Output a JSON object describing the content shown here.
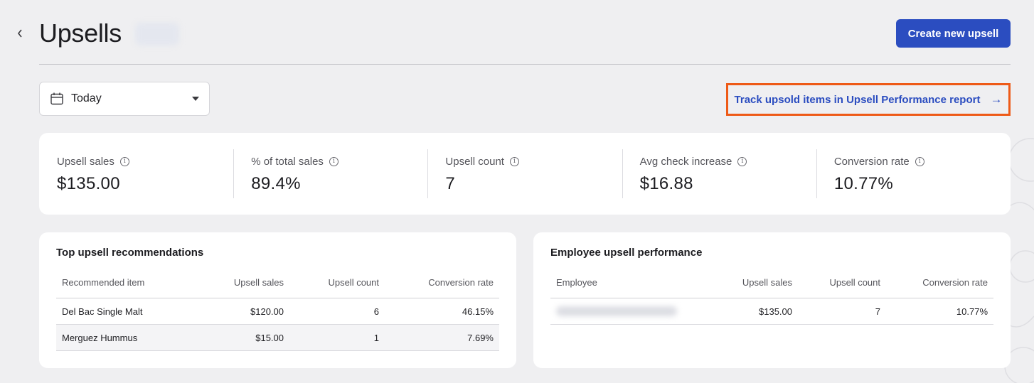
{
  "header": {
    "title": "Upsells",
    "create_button": "Create new upsell"
  },
  "filters": {
    "date_range": "Today",
    "report_link": "Track upsold items in Upsell Performance report",
    "report_link_arrow": "→"
  },
  "metrics": [
    {
      "label": "Upsell sales",
      "value": "$135.00"
    },
    {
      "label": "% of total sales",
      "value": "89.4%"
    },
    {
      "label": "Upsell count",
      "value": "7"
    },
    {
      "label": "Avg check increase",
      "value": "$16.88"
    },
    {
      "label": "Conversion rate",
      "value": "10.77%"
    }
  ],
  "top_upsells": {
    "title": "Top upsell recommendations",
    "columns": [
      "Recommended item",
      "Upsell sales",
      "Upsell count",
      "Conversion rate"
    ],
    "rows": [
      {
        "item": "Del Bac Single Malt",
        "sales": "$120.00",
        "count": "6",
        "rate": "46.15%"
      },
      {
        "item": "Merguez Hummus",
        "sales": "$15.00",
        "count": "1",
        "rate": "7.69%"
      }
    ]
  },
  "employee_perf": {
    "title": "Employee upsell performance",
    "columns": [
      "Employee",
      "Upsell sales",
      "Upsell count",
      "Conversion rate"
    ],
    "rows": [
      {
        "sales": "$135.00",
        "count": "7",
        "rate": "10.77%"
      }
    ]
  },
  "colors": {
    "primary": "#2b4dc0",
    "highlight_border": "#ee5a17",
    "background": "#efeff1"
  }
}
